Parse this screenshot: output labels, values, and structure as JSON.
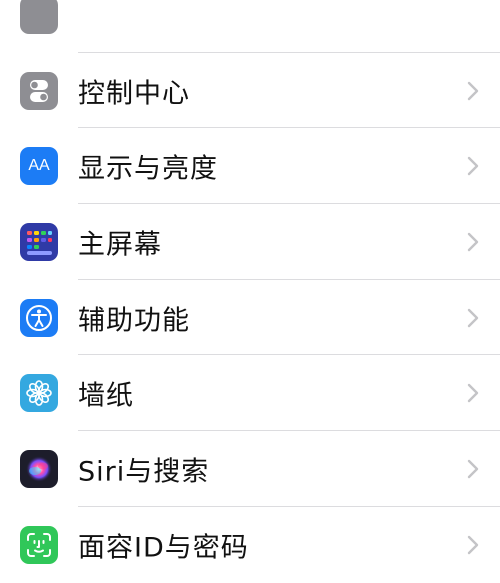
{
  "settings": {
    "items": [
      {
        "label": ""
      },
      {
        "label": "控制中心",
        "icon": "control-center-icon",
        "color": "#8e8e93"
      },
      {
        "label": "显示与亮度",
        "icon": "display-brightness-icon",
        "color": "#1c7cf5",
        "glyph": "AA"
      },
      {
        "label": "主屏幕",
        "icon": "home-screen-icon",
        "color": "#2f3aa6"
      },
      {
        "label": "辅助功能",
        "icon": "accessibility-icon",
        "color": "#1c7cf5"
      },
      {
        "label": "墙纸",
        "icon": "wallpaper-icon",
        "color": "#34a8e0"
      },
      {
        "label": "Siri与搜索",
        "icon": "siri-icon",
        "color": "#1d1d2b"
      },
      {
        "label": "面容ID与密码",
        "icon": "face-id-icon",
        "color": "#30c759"
      }
    ]
  }
}
